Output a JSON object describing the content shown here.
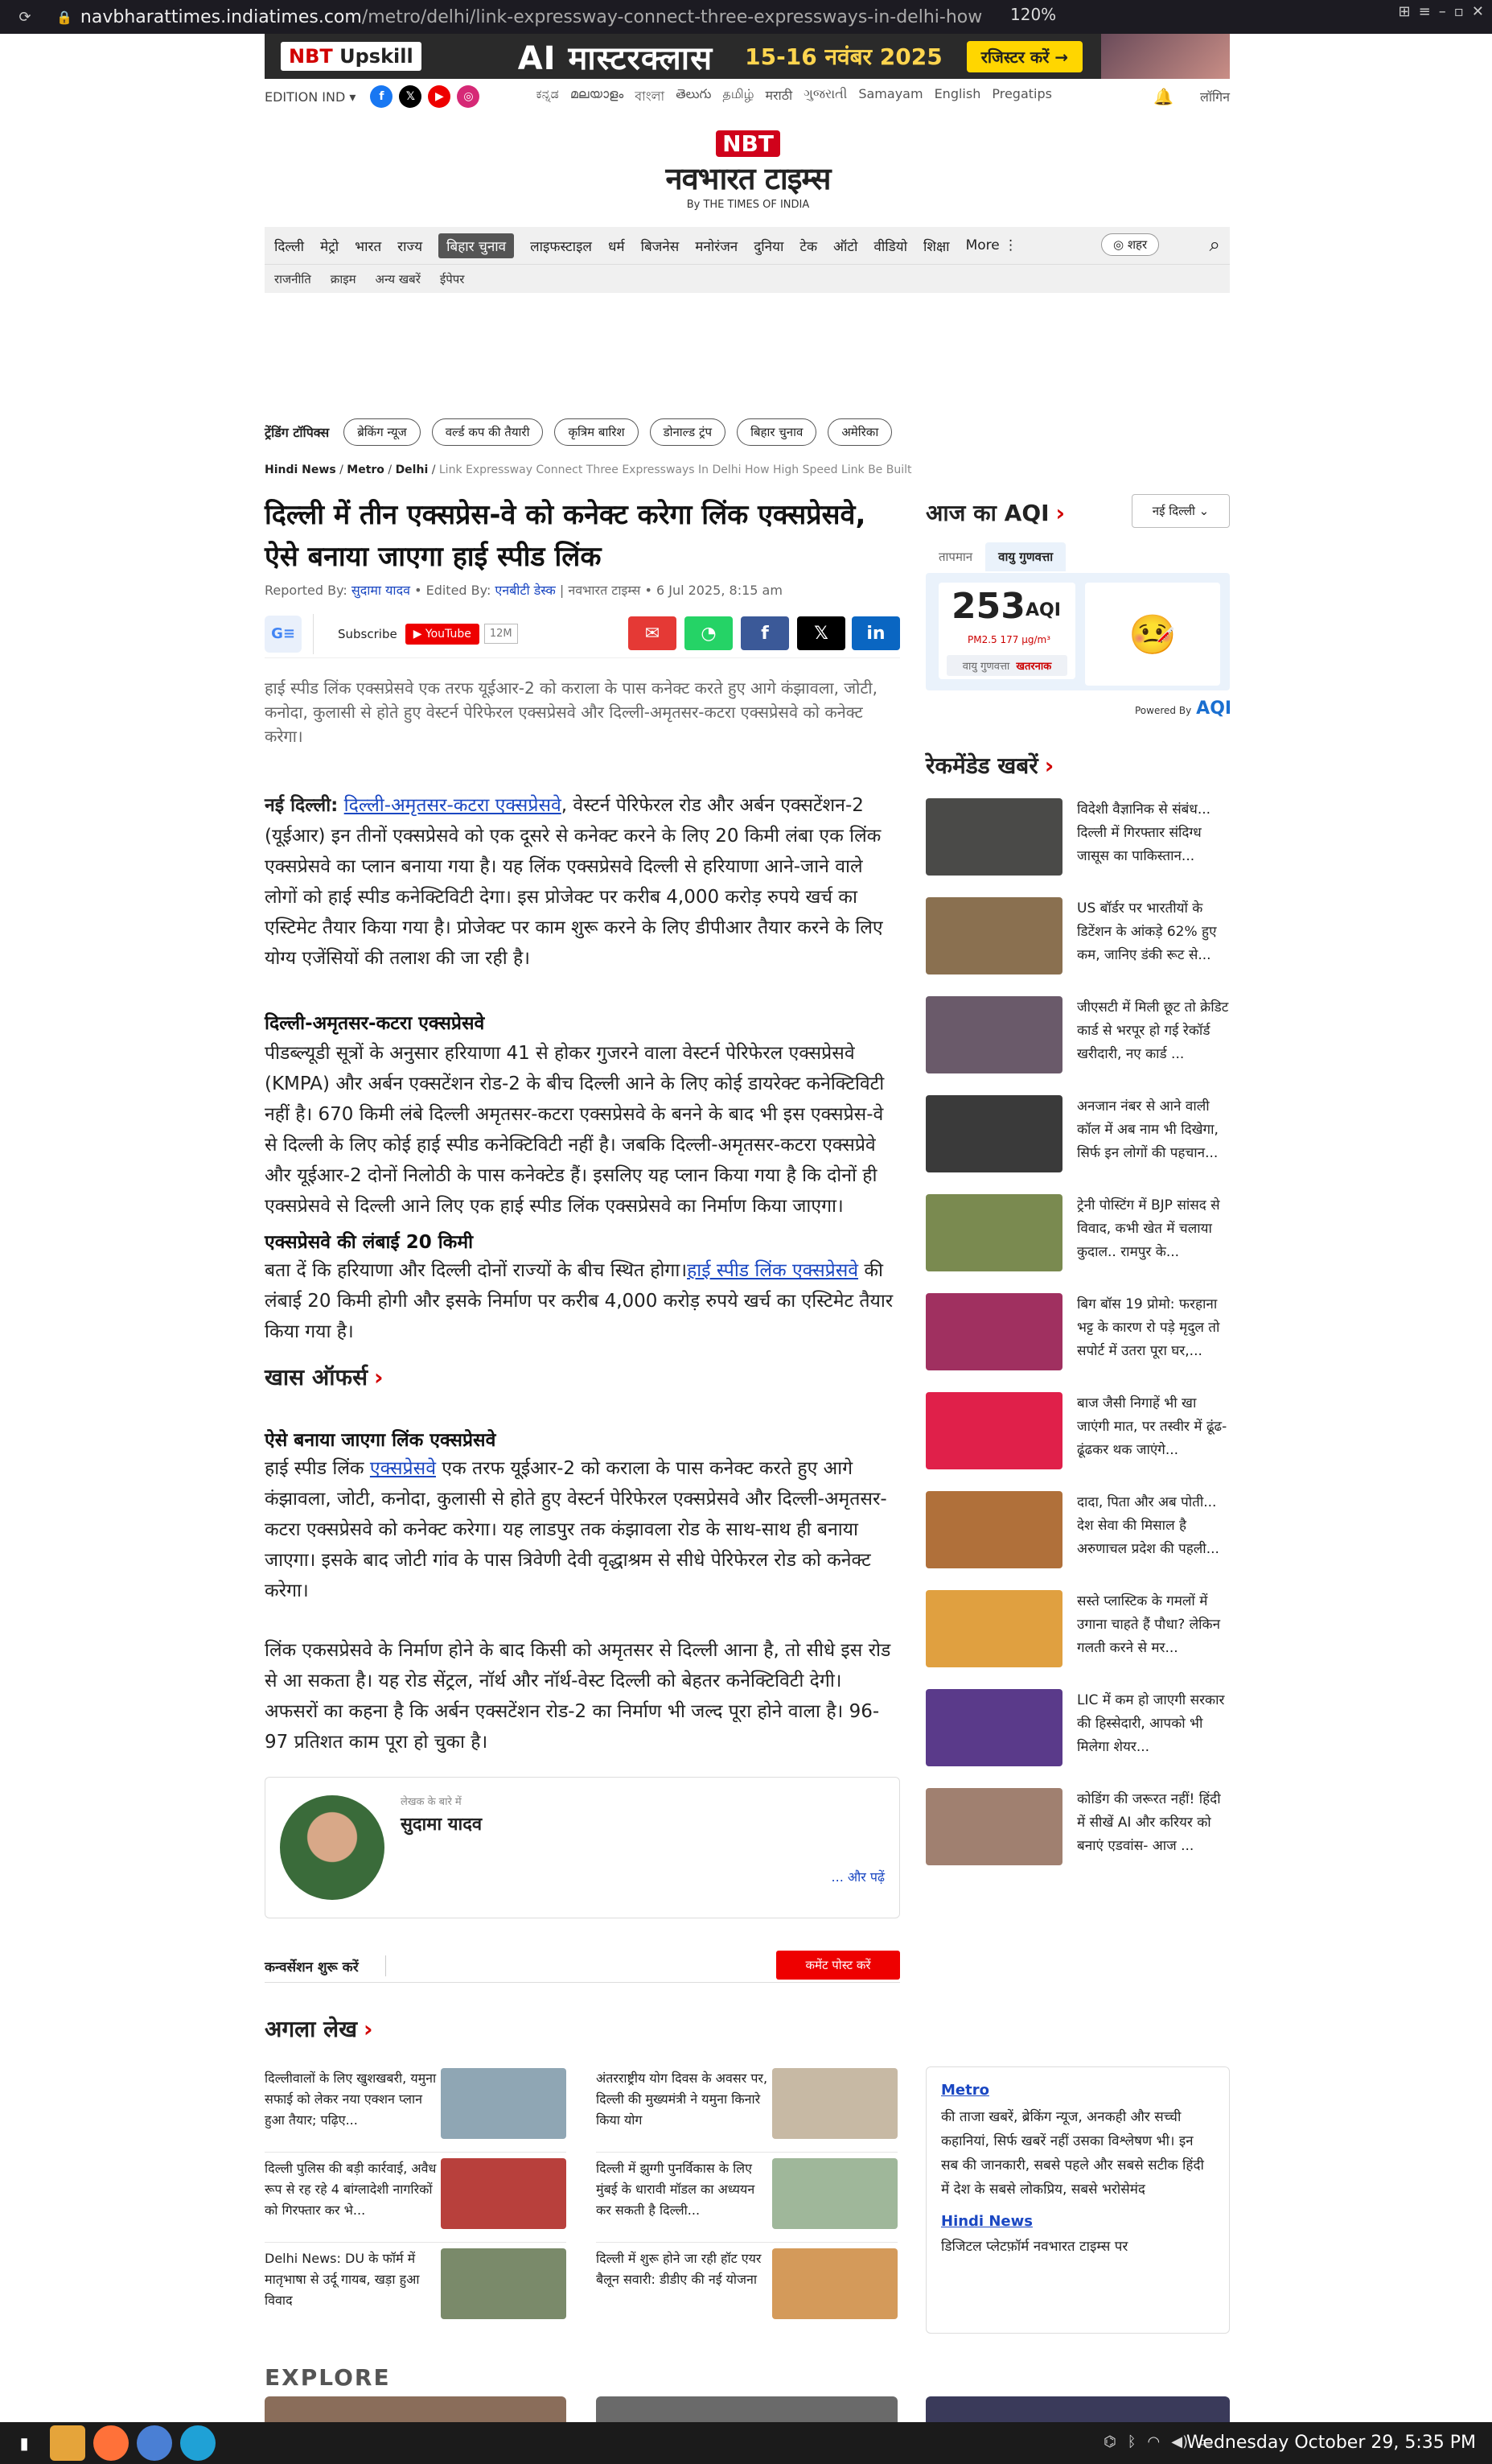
{
  "browser": {
    "url_host": "navbharattimes.indiatimes.com",
    "url_path": "/metro/delhi/link-expressway-connect-three-expressways-in-delhi-how",
    "zoom": "120%"
  },
  "ad": {
    "brand": "NBT",
    "brand2": "Upskill",
    "title": "AI मास्टरक्लास",
    "date": "15-16 नवंबर 2025",
    "cta": "रजिस्टर करें →"
  },
  "topbar": {
    "edition": "EDITION IND ▾",
    "langs": [
      "ಕನ್ನಡ",
      "മലയാളം",
      "বাংলা",
      "తెలుగు",
      "தமிழ்",
      "मराठी",
      "ગુજરાતી",
      "Samayam",
      "English",
      "Pregatips"
    ],
    "login": "लॉगिन"
  },
  "logo": {
    "nbt": "NBT",
    "name": "नवभारत टाइम्स",
    "by": "By THE TIMES OF INDIA"
  },
  "nav": {
    "items": [
      "दिल्ली",
      "मेट्रो",
      "भारत",
      "राज्य",
      "बिहार चुनाव",
      "लाइफस्टाइल",
      "धर्म",
      "बिजनेस",
      "मनोरंजन",
      "दुनिया",
      "टेक",
      "ऑटो",
      "वीडियो",
      "शिक्षा",
      "More ⋮"
    ],
    "city": "◎ शहर"
  },
  "subnav": [
    "राजनीति",
    "क्राइम",
    "अन्य खबरें",
    "ईपेपर"
  ],
  "trending": {
    "label": "ट्रेंडिंग टॉपिक्स",
    "chips": [
      "ब्रेकिंग न्यूज",
      "वर्ल्ड कप की तैयारी",
      "कृत्रिम बारिश",
      "डोनाल्ड ट्रंप",
      "बिहार चुनाव",
      "अमेरिका"
    ]
  },
  "crumb": {
    "a": "Hindi News",
    "b": "Metro",
    "c": "Delhi",
    "d": "Link Expressway Connect Three Expressways In Delhi How High Speed Link Be Built"
  },
  "article": {
    "headline": "दिल्ली में तीन एक्सप्रेस-वे को कनेक्ट करेगा लिंक एक्सप्रेसवे, ऐसे बनाया जाएगा हाई स्पीड लिंक",
    "reported_by_label": "Reported By:",
    "reporter": "सुदामा यादव",
    "edited_by_label": "• Edited By:",
    "editor": "एनबीटी डेस्क",
    "meta": "| नवभारत टाइम्स • 6 Jul 2025, 8:15 am",
    "subscribe": "Subscribe",
    "youtube": "YouTube",
    "yt_count": "12M",
    "summary": "हाई स्पीड लिंक एक्सप्रेसवे एक तरफ यूईआर-2 को कराला के पास कनेक्ट करते हुए आगे कंझावला, जोटी, कनोदा, कुलासी से होते हुए वेस्टर्न पेरिफेरल एक्सप्रेसवे और दिल्ली-अमृतसर-कटरा एक्सप्रेसवे को कनेक्ट करेगा।",
    "p1_lead": "नई दिल्ली:",
    "p1_link": "दिल्ली-अमृतसर-कटरा एक्सप्रेसवे",
    "p1_rest": ", वेस्टर्न पेरिफेरल रोड और अर्बन एक्सटेंशन-2 (यूईआर) इन तीनों एक्सप्रेसवे को एक दूसरे से कनेक्ट करने के लिए 20 किमी लंबा एक लिंक एक्सप्रेसवे का प्लान बनाया गया है। यह लिंक एक्सप्रेसवे दिल्ली से हरियाणा आने-जाने वाले लोगों को हाई स्पीड कनेक्टिविटी देगा। इस प्रोजेक्ट पर करीब 4,000 करोड़ रुपये खर्च का एस्टिमेट तैयार किया गया है। प्रोजेक्ट पर काम शुरू करने के लिए डीपीआर तैयार करने के लिए योग्य एजेंसियों की तलाश की जा रही है।",
    "h2": "दिल्ली-अमृतसर-कटरा एक्सप्रेसवे",
    "p2": "पीडब्ल्यूडी सूत्रों के अनुसार हरियाणा 41 से होकर गुजरने वाला वेस्टर्न पेरिफेरल एक्सप्रेसवे (KMPA) और अर्बन एक्सटेंशन रोड-2 के बीच दिल्ली आने के लिए कोई डायरेक्ट कनेक्टिविटी नहीं है। 670 किमी लंबे दिल्ली अमृतसर-कटरा एक्सप्रेसवे के बनने के बाद भी इस एक्सप्रेस-वे से दिल्ली के लिए कोई हाई स्पीड कनेक्टिविटी नहीं है। जबकि दिल्ली-अमृतसर-कटरा एक्सप्रेवे और यूईआर-2 दोनों निलोठी के पास कनेक्टेड हैं। इसलिए यह प्लान किया गया है कि दोनों ही एक्सप्रेसवे से दिल्ली आने लिए एक हाई स्पीड लिंक एक्सप्रेसवे का निर्माण किया जाएगा।",
    "h3": "एक्सप्रेसवे की लंबाई 20 किमी",
    "p3_a": "बता दें कि हरियाणा और दिल्ली दोनों राज्यों के बीच स्थित होगा।",
    "p3_link": "हाई स्पीड लिंक एक्सप्रेसवे",
    "p3_b": " की लंबाई 20 किमी होगी और इसके निर्माण पर करीब 4,000 करोड़ रुपये खर्च का एस्टिमेट तैयार किया गया है।",
    "khas": "खास ऑफर्स",
    "h4": "ऐसे बनाया जाएगा लिंक एक्सप्रेसवे",
    "p4_a": "हाई स्पीड लिंक ",
    "p4_link": "एक्सप्रेसवे",
    "p4_b": " एक तरफ यूईआर-2 को कराला के पास कनेक्ट करते हुए आगे कंझावला, जोटी, कनोदा, कुलासी से होते हुए वेस्टर्न पेरिफेरल एक्सप्रेसवे और दिल्ली-अमृतसर-कटरा एक्सप्रेसवे को कनेक्ट करेगा। यह लाडपुर तक कंझावला रोड के साथ-साथ ही बनाया जाएगा। इसके बाद जोटी गांव के पास त्रिवेणी देवी वृद्धाश्रम से सीधे पेरिफेरल रोड को कनेक्ट करेगा।",
    "p5": "लिंक एकसप्रेसवे के निर्माण होने के बाद किसी को अमृतसर से दिल्ली आना है, तो सीधे इस रोड से आ सकता है। यह रोड सेंट्रल, नॉर्थ और नॉर्थ-वेस्ट दिल्ली को बेहतर कनेक्टिविटी देगी। अफसरों का कहना है कि अर्बन एक्सटेंशन रोड-2 का निर्माण भी जल्द पूरा होने वाला है। 96-97 प्रतिशत काम पूरा हो चुका है।"
  },
  "author": {
    "label": "लेखक के बारे में",
    "name": "सुदामा यादव",
    "more": "... और पढ़ें"
  },
  "comment": {
    "label": "कन्वर्सेशन शुरू करें",
    "button": "कमेंट पोस्ट करें"
  },
  "next": {
    "label": "अगला लेख",
    "cards": [
      "दिल्लीवालों के लिए खुशखबरी, यमुना सफाई को लेकर नया एक्शन प्लान हुआ तैयार; पढ़िए...",
      "अंतरराष्ट्रीय योग दिवस के अवसर पर, दिल्ली की मुख्यमंत्री ने यमुना किनारे किया योग",
      "दिल्ली पुलिस की बड़ी कार्रवाई, अवैध रूप से रह रहे 4 बांग्लादेशी नागरिकों को गिरफ्तार कर भे...",
      "दिल्ली में झुग्गी पुनर्विकास के लिए मुंबई के धारावी मॉडल का अध्ययन कर सकती है दिल्ली...",
      "Delhi News: DU के फॉर्म में मातृभाषा से उर्दू गायब, खड़ा हुआ विवाद",
      "दिल्ली में शुरू होने जा रही हॉट एयर बैलून सवारी: डीडीए की नई योजना"
    ]
  },
  "metrobox": {
    "title": "Metro",
    "text": "की ताजा खबरें, ब्रेकिंग न्यूज, अनकही और सच्ची कहानियां, सिर्फ खबरें नहीं उसका विश्लेषण भी। इन सब की जानकारी, सबसे पहले और सबसे सटीक हिंदी में देश के सबसे लोकप्रिय, सबसे भरोसेमंद",
    "title2": "Hindi News",
    "text2": "डिजिटल प्लेटफ़ॉर्म नवभारत टाइम्स पर"
  },
  "explore": "EXPLORE",
  "aqi": {
    "title": "आज का AQI",
    "city": "नई दिल्ली ⌄",
    "tab1": "तापमान",
    "tab2": "वायु गुणवत्ता",
    "value": "253",
    "unit": "AQI",
    "pm": "PM2.5 177 µg/m³",
    "status_label": "वायु गुणवत्ता",
    "status": "खतरनाक",
    "powered": "Powered By",
    "powered_brand": "AQI"
  },
  "recommended": {
    "title": "रेकमेंडेड खबरें",
    "items": [
      "विदेशी वैज्ञानिक से संबंध... दिल्ली में गिरफ्तार संदिग्ध जासूस का पाकिस्तान...",
      "US बॉर्डर पर भारतीयों के डिटेंशन के आंकड़े 62% हुए कम, जानिए डंकी रूट से...",
      "जीएसटी में मिली छूट तो क्रेडिट कार्ड से भरपूर हो गई रेकॉर्ड खरीदारी, नए कार्ड ...",
      "अनजान नंबर से आने वाली कॉल में अब नाम भी दिखेगा, सिर्फ इन लोगों की पहचान...",
      "ट्रेनी पोस्टिंग में BJP सांसद से विवाद, कभी खेत में चलाया कुदाल.. रामपुर के...",
      "बिग बॉस 19 प्रोमो: फरहाना भट्ट के कारण रो पड़े मृदुल तो सपोर्ट में उतरा पूरा घर,...",
      "बाज जैसी निगाहें भी खा जाएंगी मात, पर तस्वीर में ढूंढ-ढूंढकर थक जाएंगे...",
      "दादा, पिता और अब पोती... देश सेवा की मिसाल है अरुणाचल प्रदेश की पहली...",
      "सस्ते प्लास्टिक के गमलों में उगाना चाहते हैं पौधा? लेकिन गलती करने से मर...",
      "LIC में कम हो जाएगी सरकार की हिस्सेदारी, आपको भी मिलेगा शेयर...",
      "कोडिंग की जरूरत नहीं! हिंदी में सीखें AI और करियर को बनाएं एडवांस- आज ..."
    ]
  },
  "taskbar": {
    "clock": "Wednesday October 29, 5:35 PM"
  }
}
